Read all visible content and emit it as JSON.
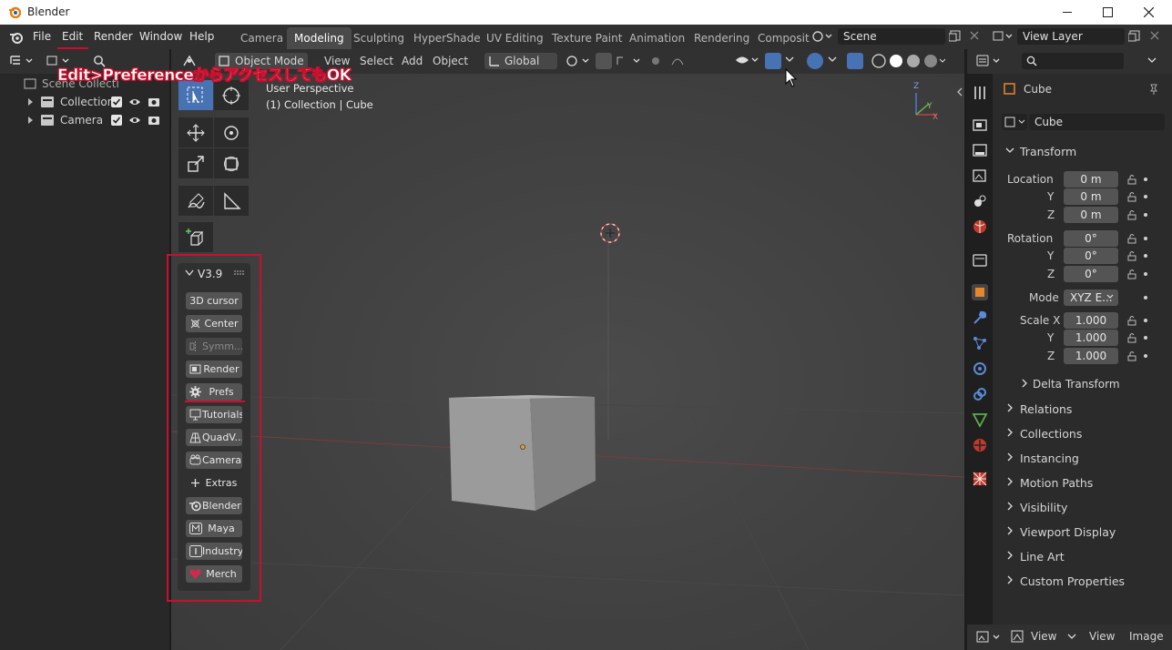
{
  "window": {
    "title": "Blender"
  },
  "topbar": {
    "menus": [
      "File",
      "Edit",
      "Render",
      "Window",
      "Help"
    ],
    "workspaces": [
      "Camera",
      "Modeling",
      "Sculpting",
      "HyperShade",
      "UV Editing",
      "Texture Paint",
      "Animation",
      "Rendering",
      "Composit"
    ],
    "scene": "Scene",
    "view_layer": "View Layer"
  },
  "outliner": {
    "root": "Scene Collecti",
    "items": [
      "Collection",
      "Camera"
    ]
  },
  "viewport": {
    "mode": "Object Mode",
    "menus": [
      "View",
      "Select",
      "Add",
      "Object"
    ],
    "orientation": "Global",
    "perspective": "User Perspective",
    "context": "(1) Collection | Cube",
    "axis_labels": [
      "Z",
      "Y",
      "X"
    ]
  },
  "npanel": {
    "title": "V3.9",
    "buttons": [
      "3D cursor",
      "Center",
      "Symm...",
      "Render",
      "Prefs",
      "Tutorials",
      "QuadV...",
      "Camera",
      "Extras",
      "Blender",
      "Maya",
      "Industry",
      "Merch"
    ]
  },
  "annotation": {
    "text": "Edit>PreferenceからアクセスしてもOK"
  },
  "properties": {
    "object_name": "Cube",
    "datablock": "Cube",
    "transform_title": "Transform",
    "location_label": "Location",
    "location": [
      "0 m",
      "0 m",
      "0 m"
    ],
    "rotation_label": "Rotation",
    "rotation": [
      "0°",
      "0°",
      "0°"
    ],
    "mode_label": "Mode",
    "mode_value": "XYZ E...",
    "scale_label": "Scale X",
    "scale": [
      "1.000",
      "1.000",
      "1.000"
    ],
    "axis_y": "Y",
    "axis_z": "Z",
    "delta": "Delta Transform",
    "sections": [
      "Relations",
      "Collections",
      "Instancing",
      "Motion Paths",
      "Visibility",
      "Viewport Display",
      "Line Art",
      "Custom Properties"
    ]
  },
  "bottombar": {
    "menus": [
      "View",
      "View",
      "Image"
    ]
  },
  "colors": {
    "accent": "#4772b3",
    "annotation": "#c8102e",
    "panel": "#303030",
    "button": "#545454"
  }
}
